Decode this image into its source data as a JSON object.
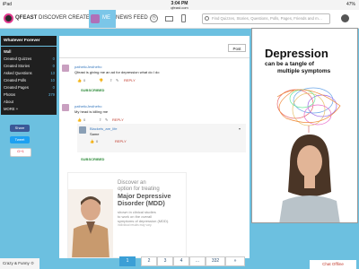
{
  "status_bar": {
    "device": "iPad",
    "time": "3:04 PM",
    "url": "qfeast.com",
    "battery": "47%"
  },
  "nav": {
    "logo": "QFEAST",
    "discover": "DISCOVER",
    "create": "CREATE",
    "me": "ME",
    "news_feed": "NEWS FEED",
    "search_placeholder": "Find Quizzes, Stories, Questions, Polls, Pages, Friends and m…"
  },
  "sidebar": {
    "header": "Whatever Forever",
    "wall": "Wall",
    "items": [
      {
        "label": "Created Quizzes",
        "count": "0"
      },
      {
        "label": "Created Stories",
        "count": "0"
      },
      {
        "label": "Asked Questions",
        "count": "13"
      },
      {
        "label": "Created Polls",
        "count": "10"
      },
      {
        "label": "Created Pages",
        "count": "0"
      },
      {
        "label": "Photos",
        "count": "379"
      },
      {
        "label": "About",
        "count": ""
      },
      {
        "label": "MORE +",
        "count": ""
      }
    ],
    "share": {
      "facebook": "Share",
      "twitter": "Tweet",
      "google": "G+1"
    }
  },
  "feed": {
    "post_button": "Post",
    "posts": [
      {
        "user": "patheticJesthefro",
        "text": "Qfeast is giving me an ad for depression what do I do",
        "likes": "0",
        "reply": "REPLY",
        "subscribe": "SUBSCRIBED"
      },
      {
        "user": "patheticJesthefro",
        "text": "My head is killing me",
        "likes": "0",
        "reply": "REPLY",
        "reply_user": "Blackets_are_life",
        "reply_text": "Same",
        "reply_likes": "0",
        "reply_reply": "REPLY",
        "subscribe": "SUBSCRIBED"
      }
    ]
  },
  "inline_ad": {
    "lines": [
      "Discover an",
      "option for treating"
    ],
    "headline": "Major Depressive Disorder (MDD)",
    "sub": [
      "shown in clinical studies",
      "to work on the overall",
      "symptoms of depression (MDD).",
      "Individual results may vary."
    ]
  },
  "right_ad": {
    "title": "Depression",
    "sub1": "can be a tangle of",
    "sub2": "multiple symptoms"
  },
  "pagination": {
    "pages": [
      "1",
      "2",
      "3",
      "4",
      "...",
      "332",
      "»"
    ],
    "current": "1"
  },
  "chat_user": "Crazy & Funny",
  "chat_status": "Chat Offline",
  "colors": {
    "accent": "#3b9fd6",
    "dark": "#1c1c1c",
    "brand_pink": "#d44a8a"
  }
}
